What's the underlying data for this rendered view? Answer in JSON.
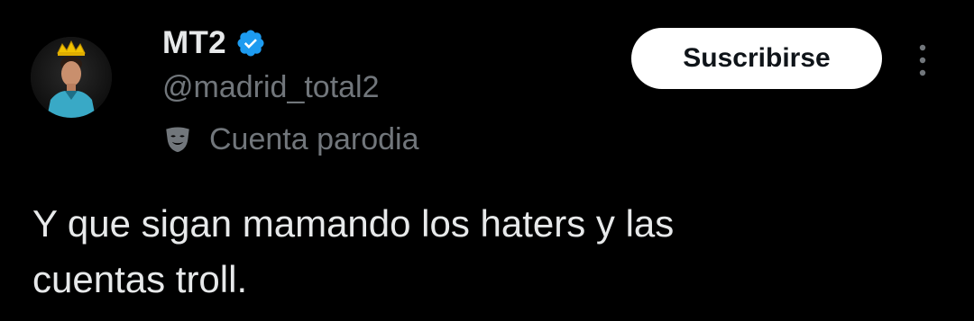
{
  "author": {
    "display_name": "MT2",
    "handle": "@madrid_total2",
    "verified_icon": "verified-badge-icon",
    "verified_color": "#1d9bf0",
    "avatar": "avatar-icon",
    "label_icon": "parody-mask-icon",
    "label_text": "Cuenta parodia"
  },
  "actions": {
    "subscribe_label": "Suscribirse",
    "more_icon": "more-vertical-icon"
  },
  "tweet": {
    "text": "Y que sigan mamando los haters y las\ncuentas troll."
  },
  "colors": {
    "background": "#000000",
    "primary_text": "#e7e9ea",
    "secondary_text": "#71767b",
    "button_bg": "#ffffff",
    "button_text": "#0f1419"
  }
}
